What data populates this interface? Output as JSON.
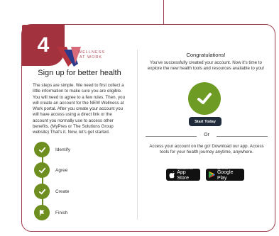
{
  "step_number": "4",
  "brand": {
    "name": "WELLNESS AT WORK",
    "colors": {
      "accent": "#a3323f",
      "success": "#6e9b23",
      "step": "#6e8e1f",
      "dark_button": "#1f2b3a"
    }
  },
  "left": {
    "title": "Sign up for better health",
    "body": "The steps are simple. We need to first collect a little information to make sure you are eligible. You will need to agree to a few rules. Then, you will create an account for the NEW Wellness at Work portal. After you create your account you will have access using a direct link or the account you normally use to access other benefits. (MyPres or The Solutions Group website) That's it. Now, let's get started.",
    "steps": [
      {
        "label": "Identify",
        "icon": "check-icon"
      },
      {
        "label": "Agree",
        "icon": "check-icon"
      },
      {
        "label": "Create",
        "icon": "check-icon"
      },
      {
        "label": "Finish",
        "icon": "flag-icon"
      }
    ]
  },
  "right": {
    "title": "Congratulations!",
    "body": "You've successfully created your account. Now it's time to explore the new health tools and resources available to you!",
    "start_button": "Start Today",
    "or_text": "Or",
    "access_text": "Access your account on the go! Download our app. Access tools for your health journey anytime, anywhere.",
    "app_store": {
      "small": "Download on the",
      "big": "App Store"
    },
    "google_play": {
      "small": "GET IT ON",
      "big": "Google Play"
    }
  }
}
